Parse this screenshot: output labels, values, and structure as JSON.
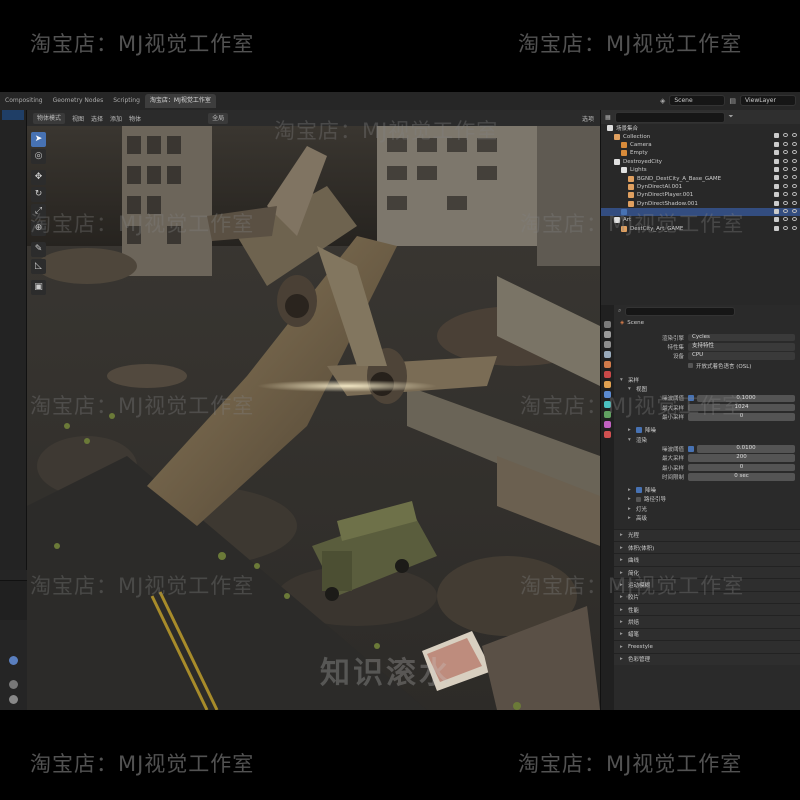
{
  "watermarks": {
    "shop": "淘宝店：MJ视觉工作室",
    "center": "知识滚水"
  },
  "topbar": {
    "tabs": [
      "Compositing",
      "Geometry Nodes",
      "Scripting",
      "淘宝店：MJ视觉工作室"
    ],
    "active_tab_index": 3,
    "scene_label": "Scene",
    "viewlayer_label": "ViewLayer"
  },
  "viewport_header": {
    "mode": "物体模式",
    "items": [
      "视图",
      "选择",
      "添加",
      "物体"
    ],
    "transform": "全局",
    "options": "选项"
  },
  "toolbar_icons": [
    "select-icon",
    "cursor-icon",
    "move-icon",
    "rotate-icon",
    "scale-icon",
    "transform-icon",
    "annotate-icon",
    "measure-icon",
    "add-cube-icon"
  ],
  "outliner": {
    "header": "场景集合",
    "rows": [
      {
        "label": "Collection",
        "indent": 1,
        "color": "#e0a060"
      },
      {
        "label": "Camera",
        "indent": 2,
        "color": "#d88b3a"
      },
      {
        "label": "Empty",
        "indent": 2,
        "color": "#d88b3a"
      },
      {
        "label": "DestroyedCity",
        "indent": 1,
        "color": "#e0e0e0"
      },
      {
        "label": "Lights",
        "indent": 2,
        "color": "#e0e0e0"
      },
      {
        "label": "BGND_DestCity_A_Base_GAME",
        "indent": 3,
        "color": "#e0a060"
      },
      {
        "label": "DynDirectAI.001",
        "indent": 3,
        "color": "#e0a060"
      },
      {
        "label": "DynDirectPlayer.001",
        "indent": 3,
        "color": "#e0a060"
      },
      {
        "label": "DynDirectShadow.001",
        "indent": 3,
        "color": "#e0a060"
      },
      {
        "label": "",
        "indent": 2,
        "color": "#4772b3",
        "selected": true
      },
      {
        "label": "Art",
        "indent": 1,
        "color": "#e0e0e0"
      },
      {
        "label": "DestCity_Art_GAME",
        "indent": 2,
        "color": "#e0a060"
      }
    ]
  },
  "properties": {
    "breadcrumb": "Scene",
    "render_engine_label": "渲染引擎",
    "render_engine": "Cycles",
    "feature_label": "特性集",
    "feature_value": "支持特性",
    "device_label": "设备",
    "device_value": "CPU",
    "osl_label": "开放式着色语言 (OSL)",
    "sampling": "采样",
    "viewport": "视图",
    "noise_threshold_label": "噪波阈值",
    "viewport_noise_threshold": "0.1000",
    "max_samples_label": "最大采样",
    "viewport_max_samples": "1024",
    "min_samples_label": "最小采样",
    "viewport_min_samples": "0",
    "denoise": "降噪",
    "render": "渲染",
    "render_noise_threshold": "0.0100",
    "render_max_samples": "200",
    "render_min_samples": "0",
    "time_limit_label": "时间限制",
    "render_time_limit": "0 sec",
    "path_guiding": "路径引导",
    "lights": "灯光",
    "advanced": "高级",
    "sections": [
      "光程",
      "体积(体积)",
      "曲线",
      "简化",
      "运动模糊",
      "胶片",
      "性能",
      "烘焙",
      "蜡笔",
      "Freestyle",
      "色彩管理"
    ]
  }
}
